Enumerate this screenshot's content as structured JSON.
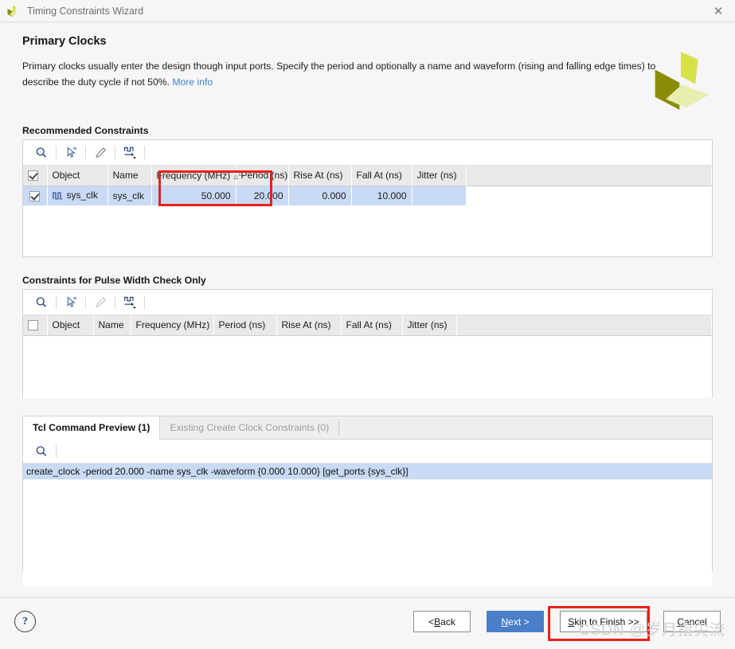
{
  "window": {
    "title": "Timing Constraints Wizard",
    "close_label": "✕",
    "app_icon": "xilinx-logo-icon"
  },
  "header": {
    "page_title": "Primary Clocks",
    "description": "Primary clocks usually enter the design though input ports. Specify the period and optionally a name and waveform (rising and falling edge times) to describe the duty cycle if not 50%.",
    "more_info_label": "More info",
    "logo_name": "xilinx-logo"
  },
  "recommended": {
    "section_title": "Recommended Constraints",
    "toolbar": [
      {
        "name": "search-icon",
        "label": "Search"
      },
      {
        "name": "select-objects-icon",
        "label": "Select Objects"
      },
      {
        "name": "edit-pencil-icon",
        "label": "Edit"
      },
      {
        "name": "clock-waveform-icon",
        "label": "Clock Waveform"
      }
    ],
    "columns": [
      "Object",
      "Name",
      "Frequency (MHz)",
      "Period (ns)",
      "Rise At (ns)",
      "Fall At (ns)",
      "Jitter (ns)"
    ],
    "sorted_column": "Frequency (MHz)",
    "sort_direction": "ascending",
    "sort_order": "1",
    "header_checkbox_checked": true,
    "rows": [
      {
        "checked": true,
        "object": "sys_clk",
        "name": "sys_clk",
        "frequency": "50.000",
        "period": "20.000",
        "rise_at": "0.000",
        "fall_at": "10.000",
        "jitter": ""
      }
    ]
  },
  "pulse_width": {
    "section_title": "Constraints for Pulse Width Check Only",
    "toolbar": [
      {
        "name": "search-icon",
        "label": "Search"
      },
      {
        "name": "select-objects-icon",
        "label": "Select Objects"
      },
      {
        "name": "edit-pencil-icon",
        "label": "Edit"
      },
      {
        "name": "clock-waveform-icon",
        "label": "Clock Waveform"
      }
    ],
    "columns": [
      "Object",
      "Name",
      "Frequency (MHz)",
      "Period (ns)",
      "Rise At (ns)",
      "Fall At (ns)",
      "Jitter (ns)"
    ],
    "header_checkbox_checked": false,
    "rows": []
  },
  "preview": {
    "tabs": [
      {
        "label": "Tcl Command Preview (1)",
        "active": true
      },
      {
        "label": "Existing Create Clock Constraints (0)",
        "active": false
      }
    ],
    "toolbar": [
      {
        "name": "search-icon",
        "label": "Search"
      }
    ],
    "lines": [
      "create_clock -period 20.000 -name sys_clk -waveform {0.000 10.000} [get_ports {sys_clk}]"
    ]
  },
  "footer": {
    "help_label": "?",
    "buttons": [
      {
        "name": "back-button",
        "pre": "< ",
        "accel": "B",
        "post": "ack",
        "style": "default"
      },
      {
        "name": "next-button",
        "pre": "",
        "accel": "N",
        "post": "ext >",
        "style": "primary"
      },
      {
        "name": "skip-to-finish-button",
        "pre": "",
        "accel": "S",
        "post": "kip to Finish >>",
        "style": "wide"
      },
      {
        "name": "cancel-button",
        "pre": "",
        "accel": "C",
        "post": "ancel",
        "style": "default"
      }
    ]
  },
  "watermark": "CSDN @岁月指尖流",
  "colors": {
    "selection": "#c9daf4",
    "highlight_box": "#e8201b",
    "primary_button": "#4a7ec8",
    "link": "#3c7fd4"
  }
}
